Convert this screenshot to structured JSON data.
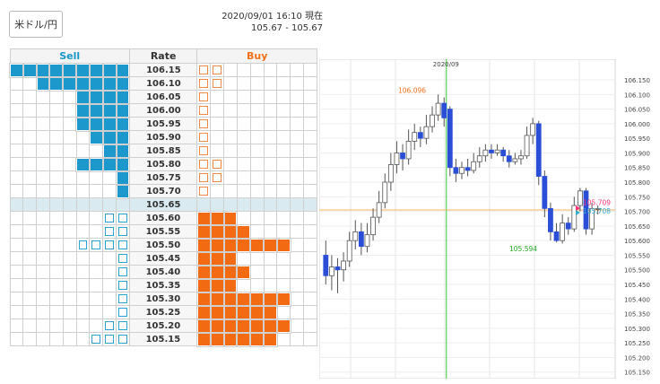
{
  "pair_select": {
    "label": "米ドル/円"
  },
  "header": {
    "timestamp": "2020/09/01 16:10 現在",
    "bid_ask": "105.67 - 105.67"
  },
  "board": {
    "columns": {
      "sell": "Sell",
      "rate": "Rate",
      "buy": "Buy"
    },
    "rows": [
      {
        "rate": "106.15",
        "sell_fill": 9,
        "sell_open": 0,
        "buy_fill": 0,
        "buy_open": 2
      },
      {
        "rate": "106.10",
        "sell_fill": 7,
        "sell_open": 0,
        "buy_fill": 0,
        "buy_open": 2
      },
      {
        "rate": "106.05",
        "sell_fill": 4,
        "sell_open": 0,
        "buy_fill": 0,
        "buy_open": 1
      },
      {
        "rate": "106.00",
        "sell_fill": 4,
        "sell_open": 0,
        "buy_fill": 0,
        "buy_open": 1
      },
      {
        "rate": "105.95",
        "sell_fill": 4,
        "sell_open": 0,
        "buy_fill": 0,
        "buy_open": 1
      },
      {
        "rate": "105.90",
        "sell_fill": 3,
        "sell_open": 0,
        "buy_fill": 0,
        "buy_open": 1
      },
      {
        "rate": "105.85",
        "sell_fill": 2,
        "sell_open": 0,
        "buy_fill": 0,
        "buy_open": 1
      },
      {
        "rate": "105.80",
        "sell_fill": 4,
        "sell_open": 0,
        "buy_fill": 0,
        "buy_open": 2
      },
      {
        "rate": "105.75",
        "sell_fill": 1,
        "sell_open": 0,
        "buy_fill": 0,
        "buy_open": 2
      },
      {
        "rate": "105.70",
        "sell_fill": 1,
        "sell_open": 0,
        "buy_fill": 0,
        "buy_open": 1
      },
      {
        "rate": "105.65",
        "sell_fill": 0,
        "sell_open": 0,
        "buy_fill": 0,
        "buy_open": 0,
        "mid": true
      },
      {
        "rate": "105.60",
        "sell_fill": 0,
        "sell_open": 2,
        "buy_fill": 3,
        "buy_open": 0
      },
      {
        "rate": "105.55",
        "sell_fill": 0,
        "sell_open": 2,
        "buy_fill": 4,
        "buy_open": 0
      },
      {
        "rate": "105.50",
        "sell_fill": 0,
        "sell_open": 4,
        "buy_fill": 7,
        "buy_open": 0
      },
      {
        "rate": "105.45",
        "sell_fill": 0,
        "sell_open": 1,
        "buy_fill": 3,
        "buy_open": 0
      },
      {
        "rate": "105.40",
        "sell_fill": 0,
        "sell_open": 1,
        "buy_fill": 4,
        "buy_open": 0
      },
      {
        "rate": "105.35",
        "sell_fill": 0,
        "sell_open": 1,
        "buy_fill": 3,
        "buy_open": 0
      },
      {
        "rate": "105.30",
        "sell_fill": 0,
        "sell_open": 1,
        "buy_fill": 7,
        "buy_open": 0
      },
      {
        "rate": "105.25",
        "sell_fill": 0,
        "sell_open": 1,
        "buy_fill": 6,
        "buy_open": 0
      },
      {
        "rate": "105.20",
        "sell_fill": 0,
        "sell_open": 2,
        "buy_fill": 7,
        "buy_open": 0
      },
      {
        "rate": "105.15",
        "sell_fill": 0,
        "sell_open": 3,
        "buy_fill": 6,
        "buy_open": 0
      }
    ]
  },
  "chart_data": {
    "type": "candlestick",
    "title": "",
    "x_label": "2020/09",
    "ylim": [
      105.14,
      106.19
    ],
    "y_ticks": [
      "106.150",
      "106.100",
      "106.050",
      "106.000",
      "105.950",
      "105.900",
      "105.850",
      "105.800",
      "105.750",
      "105.700",
      "105.650",
      "105.600",
      "105.550",
      "105.500",
      "105.450",
      "105.400",
      "105.350",
      "105.300",
      "105.250",
      "105.200",
      "105.150"
    ],
    "annotations": [
      {
        "text": "106.096",
        "value": 106.096,
        "color": "#f07018"
      },
      {
        "text": "105.594",
        "value": 105.594,
        "color": "#22aa22"
      },
      {
        "text": "105.709",
        "value": 105.709,
        "color": "#ff3377"
      },
      {
        "text": "105.708",
        "value": 105.708,
        "color": "#33aacc"
      }
    ],
    "hline": {
      "value": 105.705,
      "color": "#f5b060"
    },
    "day_separator_index": 21,
    "candles": [
      [
        105.55,
        105.48,
        105.6,
        105.45
      ],
      [
        105.48,
        105.51,
        105.55,
        105.43
      ],
      [
        105.51,
        105.5,
        105.54,
        105.42
      ],
      [
        105.5,
        105.53,
        105.56,
        105.46
      ],
      [
        105.53,
        105.6,
        105.63,
        105.51
      ],
      [
        105.6,
        105.63,
        105.67,
        105.57
      ],
      [
        105.63,
        105.58,
        105.66,
        105.55
      ],
      [
        105.58,
        105.62,
        105.66,
        105.56
      ],
      [
        105.62,
        105.68,
        105.71,
        105.6
      ],
      [
        105.68,
        105.73,
        105.77,
        105.66
      ],
      [
        105.73,
        105.8,
        105.83,
        105.71
      ],
      [
        105.8,
        105.86,
        105.9,
        105.77
      ],
      [
        105.86,
        105.9,
        105.94,
        105.83
      ],
      [
        105.9,
        105.88,
        105.93,
        105.84
      ],
      [
        105.88,
        105.94,
        105.98,
        105.86
      ],
      [
        105.94,
        105.97,
        106.0,
        105.91
      ],
      [
        105.97,
        105.95,
        105.99,
        105.92
      ],
      [
        105.95,
        105.99,
        106.03,
        105.93
      ],
      [
        105.99,
        106.03,
        106.06,
        105.97
      ],
      [
        106.03,
        106.07,
        106.1,
        106.01
      ],
      [
        106.07,
        106.02,
        106.09,
        105.99
      ],
      [
        106.05,
        105.85,
        106.06,
        105.82
      ],
      [
        105.85,
        105.83,
        105.88,
        105.8
      ],
      [
        105.83,
        105.85,
        105.87,
        105.81
      ],
      [
        105.85,
        105.84,
        105.88,
        105.82
      ],
      [
        105.84,
        105.87,
        105.9,
        105.83
      ],
      [
        105.87,
        105.89,
        105.92,
        105.85
      ],
      [
        105.89,
        105.91,
        105.93,
        105.87
      ],
      [
        105.91,
        105.9,
        105.93,
        105.88
      ],
      [
        105.9,
        105.91,
        105.93,
        105.89
      ],
      [
        105.91,
        105.89,
        105.92,
        105.87
      ],
      [
        105.89,
        105.87,
        105.91,
        105.85
      ],
      [
        105.87,
        105.88,
        105.9,
        105.86
      ],
      [
        105.88,
        105.89,
        105.91,
        105.86
      ],
      [
        105.89,
        105.96,
        105.99,
        105.88
      ],
      [
        105.96,
        106.0,
        106.02,
        105.93
      ],
      [
        106.0,
        105.82,
        106.01,
        105.79
      ],
      [
        105.82,
        105.71,
        105.84,
        105.68
      ],
      [
        105.71,
        105.63,
        105.73,
        105.6
      ],
      [
        105.63,
        105.6,
        105.66,
        105.594
      ],
      [
        105.6,
        105.66,
        105.69,
        105.59
      ],
      [
        105.66,
        105.64,
        105.68,
        105.62
      ],
      [
        105.64,
        105.72,
        105.75,
        105.63
      ],
      [
        105.72,
        105.77,
        105.78,
        105.7
      ],
      [
        105.77,
        105.64,
        105.78,
        105.62
      ],
      [
        105.64,
        105.71,
        105.73,
        105.62
      ],
      [
        105.71,
        105.71,
        105.72,
        105.69
      ]
    ]
  }
}
